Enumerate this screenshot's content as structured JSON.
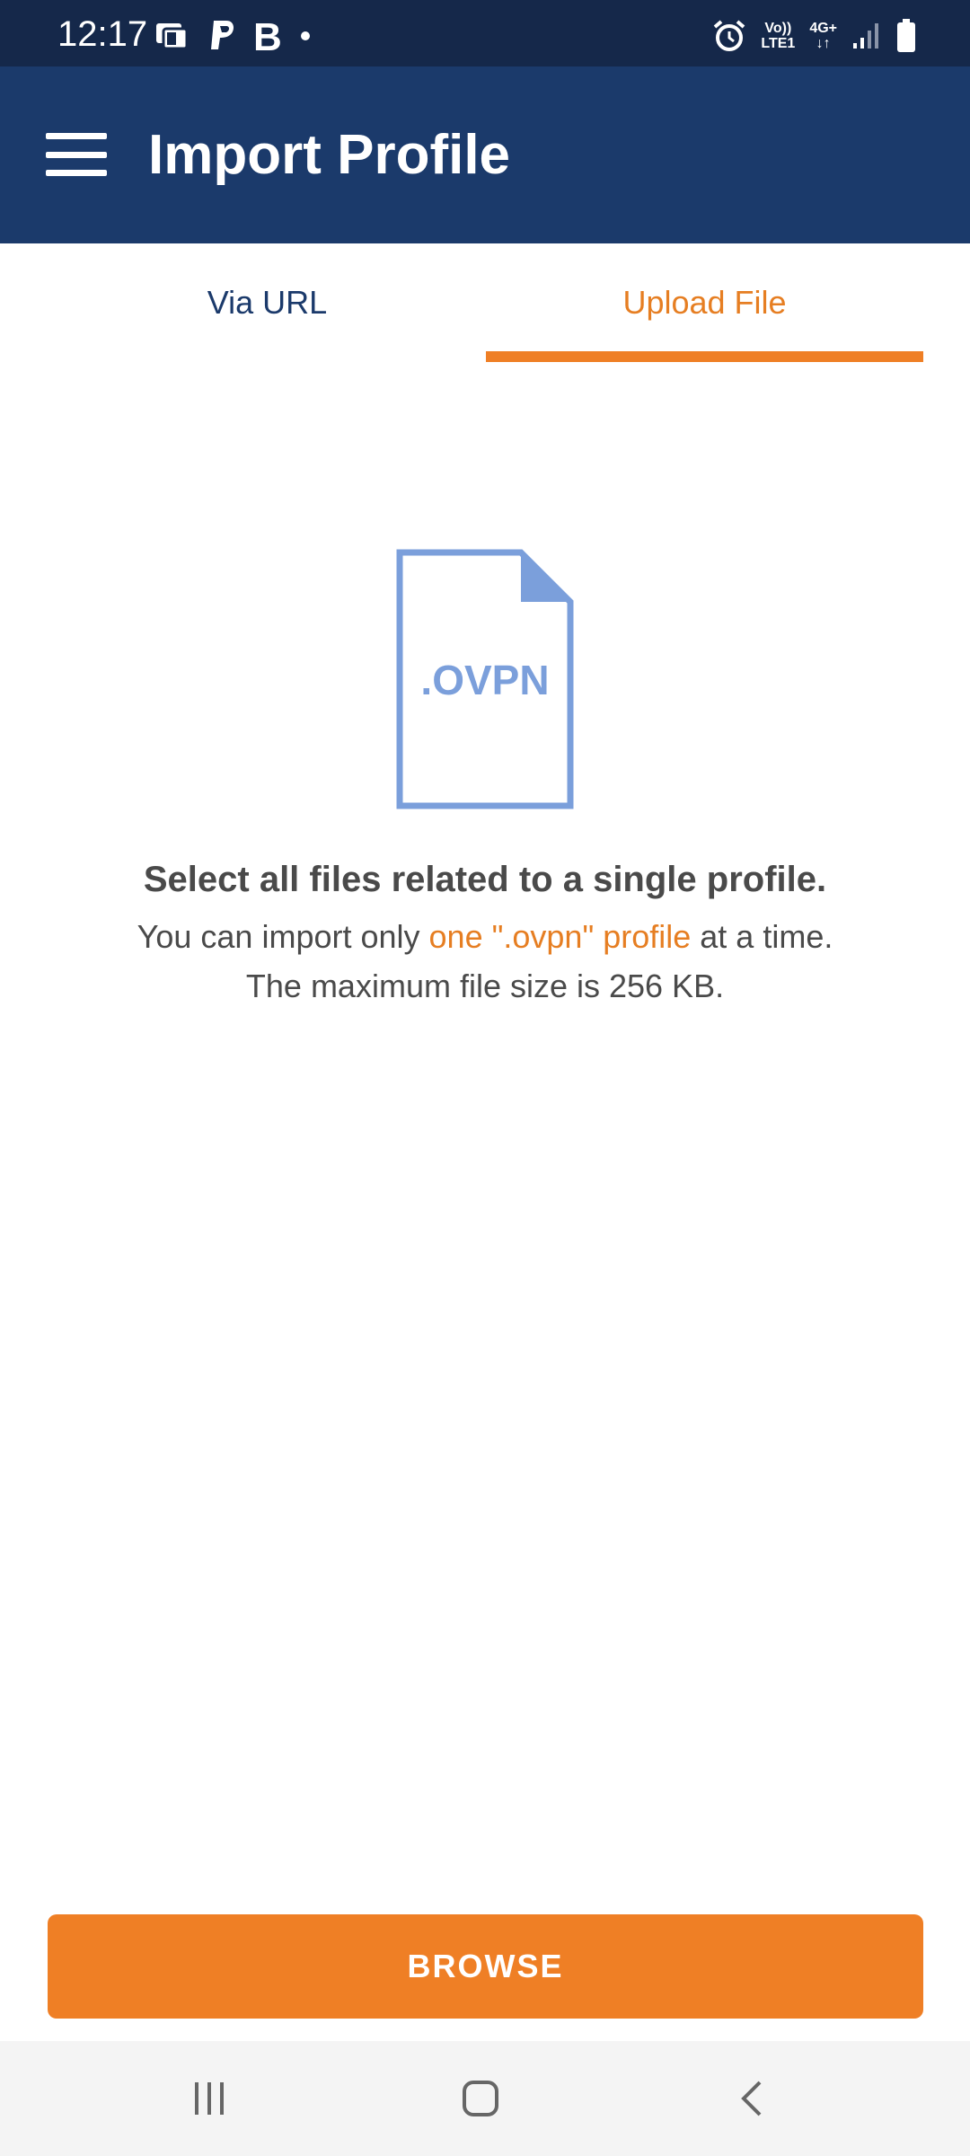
{
  "status_bar": {
    "time": "12:17",
    "left_icons": [
      "wallet-icon",
      "paypal-icon",
      "bold-b-icon",
      "dot-icon"
    ],
    "network_top": "Vo))",
    "network_bottom": "LTE1",
    "network_type": "4G+",
    "right_icons": [
      "alarm-icon",
      "signal-icon",
      "battery-icon"
    ]
  },
  "app_bar": {
    "title": "Import Profile",
    "menu_icon": "hamburger-menu-icon"
  },
  "tabs": [
    {
      "label": "Via URL",
      "active": false
    },
    {
      "label": "Upload File",
      "active": true
    }
  ],
  "file_icon": {
    "extension": ".OVPN",
    "color": "#7b9fdb"
  },
  "content": {
    "headline": "Select all files related to a single profile.",
    "line1_pre": "You can import only ",
    "line1_highlight": "one \".ovpn\" profile",
    "line1_post": " at a time.",
    "line2": "The maximum file size is 256 KB."
  },
  "browse": {
    "label": "BROWSE"
  },
  "nav_bar": {
    "icons": [
      "recent-apps-icon",
      "home-icon",
      "back-icon"
    ]
  },
  "colors": {
    "status_bar": "#15284a",
    "app_bar": "#1b3a6b",
    "accent": "#ef7f25",
    "text": "#4a4a4a"
  }
}
